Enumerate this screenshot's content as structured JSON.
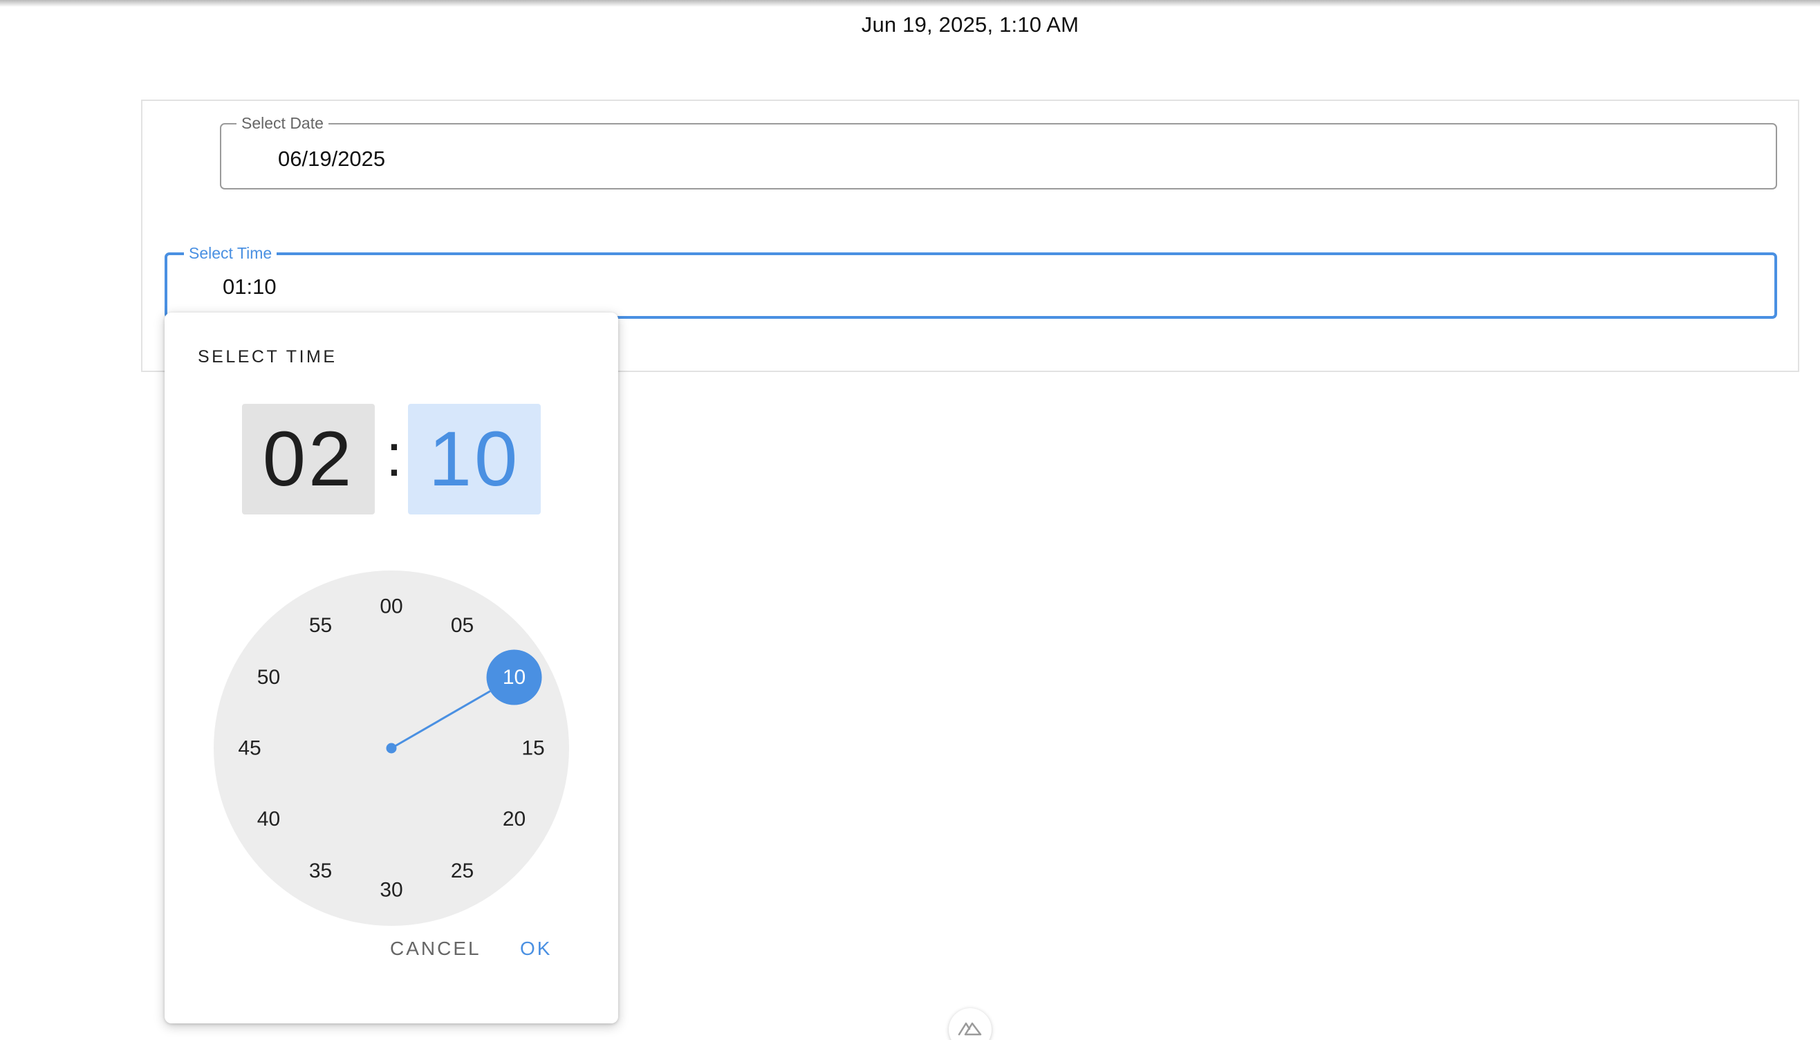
{
  "header": {
    "datetime": "Jun 19, 2025, 1:10 AM"
  },
  "form": {
    "date_field": {
      "label": "Select Date",
      "value": "06/19/2025"
    },
    "time_field": {
      "label": "Select Time",
      "value": "01:10"
    }
  },
  "picker": {
    "title": "SELECT TIME",
    "hour": "02",
    "separator": ":",
    "minute": "10",
    "selected_minute": "10",
    "clock_numbers": [
      "00",
      "05",
      "10",
      "15",
      "20",
      "25",
      "30",
      "35",
      "40",
      "45",
      "50",
      "55"
    ],
    "cancel_label": "CANCEL",
    "ok_label": "OK"
  },
  "floating": {
    "icon": "nuxt-logo-icon"
  },
  "colors": {
    "accent": "#4a90e2",
    "clock_face": "#ededed",
    "hour_box": "#e3e3e3",
    "minute_box": "#d7e7fb"
  }
}
